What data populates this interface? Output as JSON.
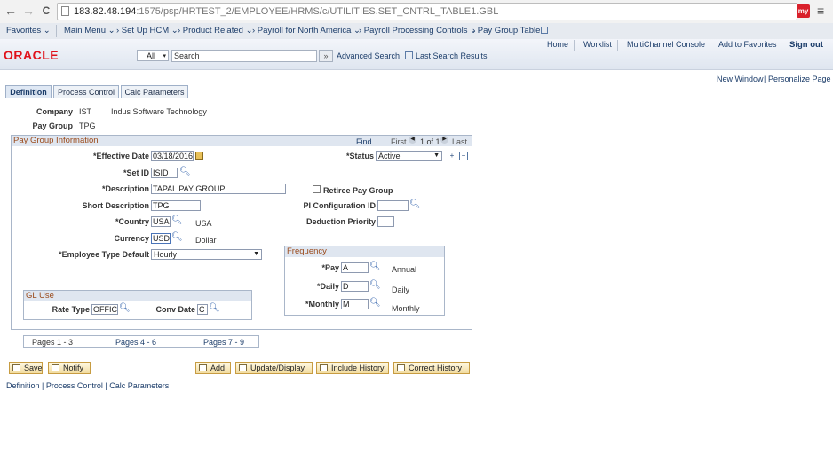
{
  "browser": {
    "url_host": "183.82.48.194",
    "url_rest": ":1575/psp/HRTEST_2/EMPLOYEE/HRMS/c/UTILITIES.SET_CNTRL_TABLE1.GBL",
    "ext_label": "my",
    "back": "←",
    "forward": "→",
    "reload": "C",
    "star": "☆",
    "menu": "≡"
  },
  "menubar": {
    "favorites": "Favorites ⌄",
    "main_menu": "Main Menu ⌄",
    "crumbs": [
      "› Set Up HCM ⌄",
      "› Product Related ⌄",
      "› Payroll for North America ⌄",
      "› Payroll Processing Controls ⌄",
      "› Pay Group Table"
    ]
  },
  "header": {
    "logo": "ORACLE",
    "links": [
      "Home",
      "Worklist",
      "MultiChannel Console",
      "Add to Favorites",
      "Sign out"
    ],
    "search_scope": "All",
    "search_placeholder": "Search",
    "go": "»",
    "advanced_search": "Advanced Search",
    "last_search": "Last Search Results"
  },
  "page_links": {
    "new_window": "New Window",
    "divider": "|",
    "personalize": "Personalize Page"
  },
  "tabs": [
    "Definition",
    "Process Control",
    "Calc Parameters"
  ],
  "top_fields": {
    "company_label": "Company",
    "company_code": "IST",
    "company_name": "Indus Software Technology",
    "paygroup_label": "Pay Group",
    "paygroup_code": "TPG"
  },
  "pay_group_info": {
    "title": "Pay Group Information",
    "find": "Find",
    "first": "First",
    "counter": "1 of 1",
    "last": "Last",
    "effective_date_label": "*Effective Date",
    "effective_date": "03/18/2016",
    "status_label": "*Status",
    "status_value": "Active",
    "setid_label": "*Set ID",
    "setid_value": "ISID",
    "description_label": "*Description",
    "description_value": "TAPAL PAY GROUP",
    "retiree_label": "Retiree Pay Group",
    "short_desc_label": "Short Description",
    "short_desc_value": "TPG",
    "pi_config_label": "PI Configuration ID",
    "country_label": "*Country",
    "country_value": "USA",
    "country_desc": "USA",
    "deduction_priority_label": "Deduction Priority",
    "currency_label": "Currency",
    "currency_value": "USD",
    "currency_desc": "Dollar",
    "emp_type_label": "*Employee Type Default",
    "emp_type_value": "Hourly"
  },
  "frequency": {
    "title": "Frequency",
    "pay_label": "*Pay",
    "pay_value": "A",
    "pay_desc": "Annual",
    "daily_label": "*Daily",
    "daily_value": "D",
    "daily_desc": "Daily",
    "monthly_label": "*Monthly",
    "monthly_value": "M",
    "monthly_desc": "Monthly"
  },
  "gl_use": {
    "title": "GL Use",
    "rate_type_label": "Rate Type",
    "rate_type_value": "OFFIC",
    "conv_date_label": "Conv Date",
    "conv_date_value": "C"
  },
  "pages_nav": [
    "Pages 1 - 3",
    "Pages 4 - 6",
    "Pages 7 - 9"
  ],
  "buttons": {
    "save": "Save",
    "notify": "Notify",
    "add": "Add",
    "update_display": "Update/Display",
    "include_history": "Include History",
    "correct_history": "Correct History"
  },
  "bottom_links": "Definition | Process Control | Calc Parameters"
}
